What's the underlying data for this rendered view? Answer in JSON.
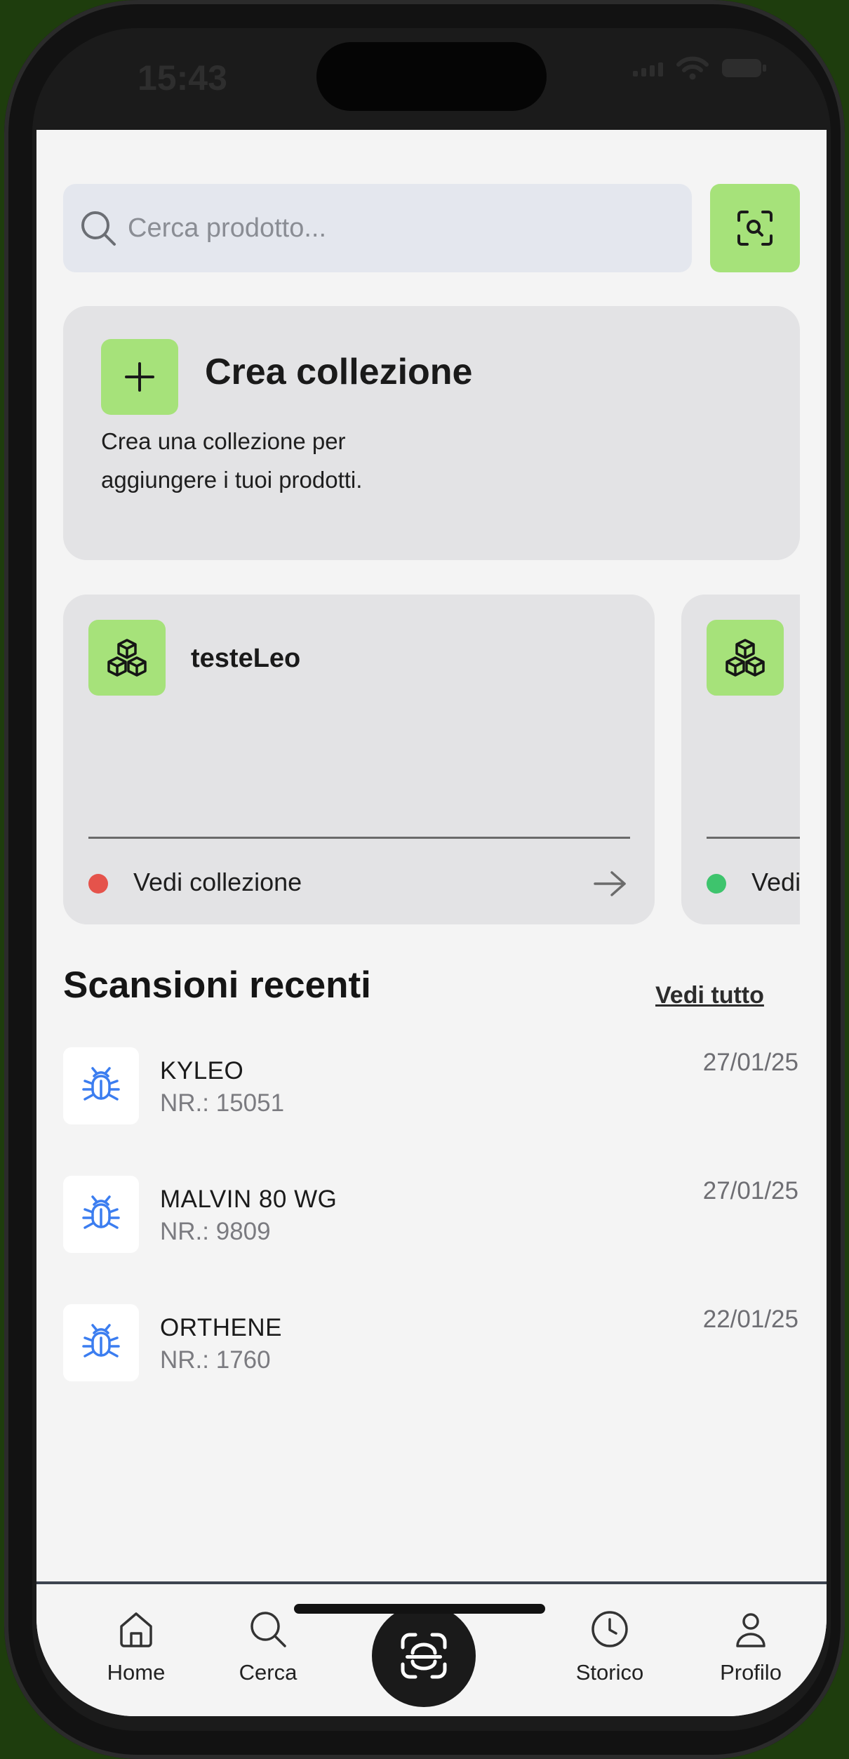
{
  "status_bar": {
    "time": "15:43"
  },
  "search": {
    "placeholder": "Cerca prodotto..."
  },
  "create_collection": {
    "title": "Crea collezione",
    "description": "Crea una collezione per aggiungere i tuoi prodotti."
  },
  "collections": [
    {
      "name": "testeLeo",
      "link_label": "Vedi collezione",
      "status_color": "#e5534b"
    },
    {
      "name": "",
      "link_label": "Vedi collezione",
      "status_color": "#3ec46d"
    }
  ],
  "recent": {
    "title": "Scansioni recenti",
    "see_all": "Vedi tutto",
    "items": [
      {
        "name": "KYLEO",
        "nr": "NR.: 15051",
        "date": "27/01/25",
        "icon": "bug-icon"
      },
      {
        "name": "MALVIN 80 WG",
        "nr": "NR.: 9809",
        "date": "27/01/25",
        "icon": "bug-icon"
      },
      {
        "name": "ORTHENE",
        "nr": "NR.: 1760",
        "date": "22/01/25",
        "icon": "bug-icon"
      }
    ]
  },
  "tabbar": {
    "home": "Home",
    "search": "Cerca",
    "history": "Storico",
    "profile": "Profilo"
  },
  "colors": {
    "accent_green": "#a6e27a",
    "bug_icon_blue": "#3b7df0",
    "frame_bg": "#1e3d0d"
  }
}
